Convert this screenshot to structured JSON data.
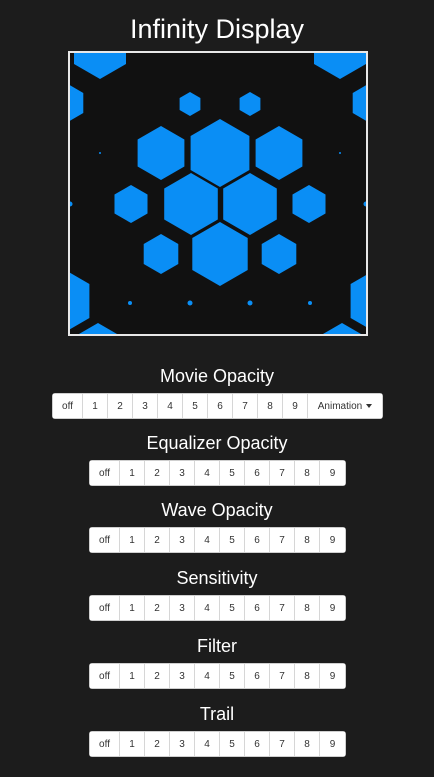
{
  "title": "Infinity Display",
  "colors": {
    "hex": "#0a8ef5",
    "background": "#1c1c1c",
    "display_bg": "#111111"
  },
  "sections": [
    {
      "label": "Movie Opacity",
      "options": [
        "off",
        "1",
        "2",
        "3",
        "4",
        "5",
        "6",
        "7",
        "8",
        "9"
      ],
      "extra": "Animation"
    },
    {
      "label": "Equalizer Opacity",
      "options": [
        "off",
        "1",
        "2",
        "3",
        "4",
        "5",
        "6",
        "7",
        "8",
        "9"
      ]
    },
    {
      "label": "Wave Opacity",
      "options": [
        "off",
        "1",
        "2",
        "3",
        "4",
        "5",
        "6",
        "7",
        "8",
        "9"
      ]
    },
    {
      "label": "Sensitivity",
      "options": [
        "off",
        "1",
        "2",
        "3",
        "4",
        "5",
        "6",
        "7",
        "8",
        "9"
      ]
    },
    {
      "label": "Filter",
      "options": [
        "off",
        "1",
        "2",
        "3",
        "4",
        "5",
        "6",
        "7",
        "8",
        "9"
      ]
    },
    {
      "label": "Trail",
      "options": [
        "off",
        "1",
        "2",
        "3",
        "4",
        "5",
        "6",
        "7",
        "8",
        "9"
      ]
    }
  ]
}
